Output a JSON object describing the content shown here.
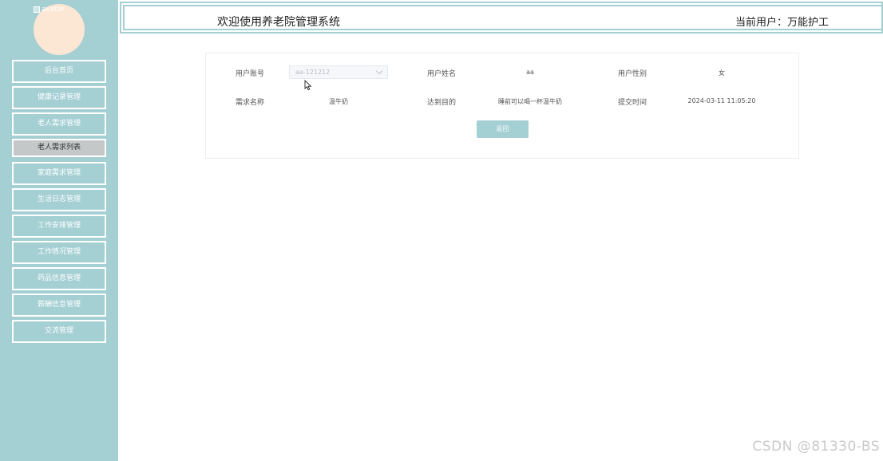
{
  "sidebar": {
    "avatar_alt": "avatar",
    "items": [
      {
        "label": "后台首页"
      },
      {
        "label": "健康记录管理"
      },
      {
        "label": "老人需求管理"
      },
      {
        "label": "老人需求列表"
      },
      {
        "label": "家庭需求管理"
      },
      {
        "label": "生活日志管理"
      },
      {
        "label": "工作安排管理"
      },
      {
        "label": "工作情况管理"
      },
      {
        "label": "药品信息管理"
      },
      {
        "label": "薪酬信息管理"
      },
      {
        "label": "交流管理"
      }
    ]
  },
  "header": {
    "title": "欢迎使用养老院管理系统",
    "current_user": "当前用户：万能护工"
  },
  "form": {
    "account_label": "用户账号",
    "account_value": "aa-121212",
    "name_label": "用户姓名",
    "name_value": "aa",
    "gender_label": "用户性别",
    "gender_value": "女",
    "need_label": "需求名称",
    "need_value": "温牛奶",
    "goal_label": "达到目的",
    "goal_value": "睡前可以喝一杯温牛奶",
    "time_label": "提交时间",
    "time_value": "2024-03-11 11:05:20",
    "back_label": "返回"
  },
  "watermark": "CSDN @81330-BS",
  "colors": {
    "accent": "#a4cfd3",
    "avatar": "#fbe7d3",
    "active_menu": "#c4c8c8"
  }
}
